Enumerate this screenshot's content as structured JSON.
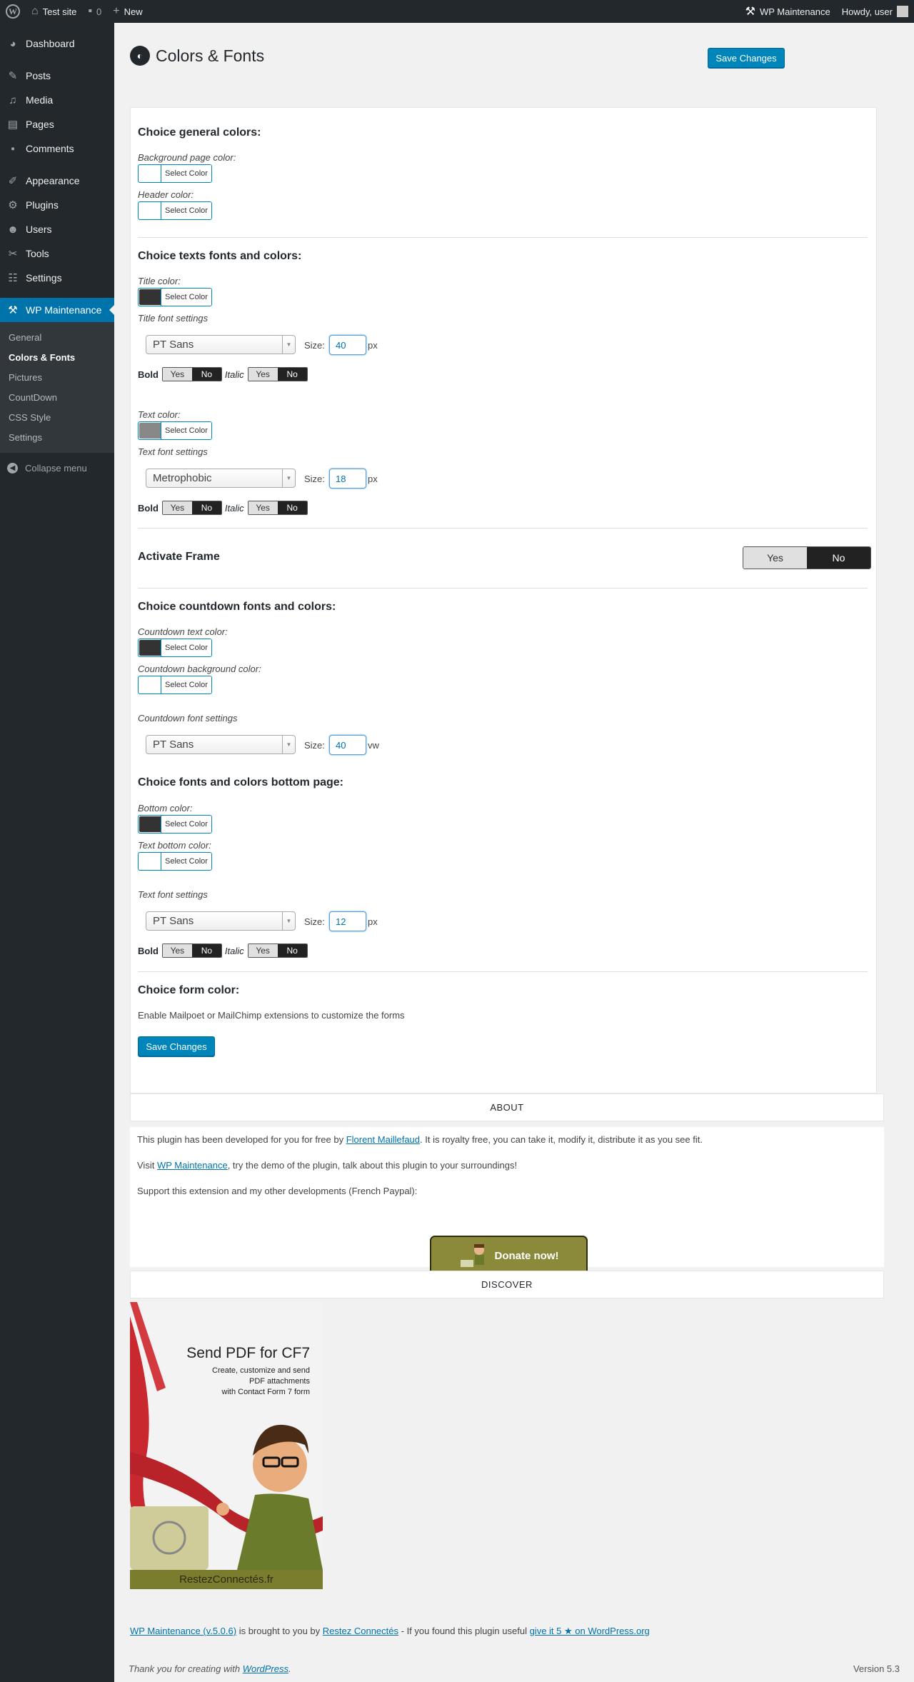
{
  "adminbar": {
    "site_name": "Test site",
    "comments_count": "0",
    "new_label": "New",
    "plugin_label": "WP Maintenance",
    "howdy": "Howdy, user"
  },
  "sidebar": {
    "items": [
      {
        "label": "Dashboard",
        "icon": "dashboard-icon"
      },
      {
        "label": "Posts",
        "icon": "pin-icon"
      },
      {
        "label": "Media",
        "icon": "media-icon"
      },
      {
        "label": "Pages",
        "icon": "pages-icon"
      },
      {
        "label": "Comments",
        "icon": "comments-icon"
      },
      {
        "label": "Appearance",
        "icon": "brush-icon"
      },
      {
        "label": "Plugins",
        "icon": "plugin-icon"
      },
      {
        "label": "Users",
        "icon": "users-icon"
      },
      {
        "label": "Tools",
        "icon": "wrench-icon"
      },
      {
        "label": "Settings",
        "icon": "settings-icon"
      },
      {
        "label": "WP Maintenance",
        "icon": "wp-maintenance-icon"
      }
    ],
    "submenu": [
      "General",
      "Colors & Fonts",
      "Pictures",
      "CountDown",
      "CSS Style",
      "Settings"
    ],
    "collapse": "Collapse menu"
  },
  "page": {
    "title": "Colors & Fonts",
    "save_label": "Save Changes"
  },
  "general_colors": {
    "title": "Choice general colors:",
    "bg_label": "Background page color:",
    "header_label": "Header color:",
    "select_label": "Select Color",
    "bg_color": "#ffffff",
    "header_color": "#ffffff"
  },
  "texts": {
    "title": "Choice texts fonts and colors:",
    "title_color_label": "Title color:",
    "title_color": "#333333",
    "title_font_label": "Title font settings",
    "title_font": "PT Sans",
    "title_size": "40",
    "title_unit": "px",
    "text_color_label": "Text color:",
    "text_color": "#888888",
    "text_font_label": "Text font settings",
    "text_font": "Metrophobic",
    "text_size": "18",
    "text_unit": "px",
    "size_label": "Size:",
    "bold_label": "Bold",
    "italic_label": "Italic",
    "yes": "Yes",
    "no": "No"
  },
  "frame": {
    "title": "Activate Frame",
    "yes": "Yes",
    "no": "No"
  },
  "countdown": {
    "title": "Choice countdown fonts and colors:",
    "text_color_label": "Countdown text color:",
    "text_color": "#333333",
    "bg_color_label": "Countdown background color:",
    "bg_color": "#ffffff",
    "font_label": "Countdown font settings",
    "font": "PT Sans",
    "size": "40",
    "unit": "vw"
  },
  "bottom": {
    "title": "Choice fonts and colors bottom page:",
    "bottom_color_label": "Bottom color:",
    "bottom_color": "#333333",
    "text_color_label": "Text bottom color:",
    "text_color": "#ffffff",
    "font_label": "Text font settings",
    "font": "PT Sans",
    "size": "12",
    "unit": "px"
  },
  "form": {
    "title": "Choice form color:",
    "desc": "Enable Mailpoet or MailChimp extensions to customize the forms",
    "save_label": "Save Changes"
  },
  "about": {
    "header": "ABOUT",
    "p1_pre": "This plugin has been developed for you for free by ",
    "p1_link": "Florent Maillefaud",
    "p1_post": ". It is royalty free, you can take it, modify it, distribute it as you see fit.",
    "p2_pre": "Visit ",
    "p2_link": "WP Maintenance",
    "p2_post": ", try the demo of the plugin, talk about this plugin to your surroundings!",
    "p3": "Support this extension and my other developments (French Paypal):",
    "donate": "Donate now!"
  },
  "discover": {
    "header": "DISCOVER",
    "promo_title": "Send PDF for CF7",
    "promo_sub": "Create, customize and send\nPDF attachments\nwith Contact Form 7 form",
    "promo_brand": "RestezConnectés.fr"
  },
  "footer": {
    "plugin_link": "WP Maintenance (v.5.0.6)",
    "mid": " is brought to you by ",
    "author_link": "Restez Connectés",
    "mid2": " - If you found this plugin useful ",
    "rate_link": "give it 5 ★ on WordPress.org",
    "thanks_pre": "Thank you for creating with ",
    "thanks_link": "WordPress",
    "thanks_post": ".",
    "version": "Version 5.3"
  }
}
